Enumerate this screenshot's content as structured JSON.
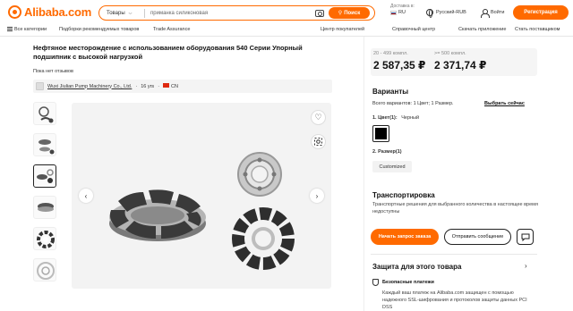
{
  "header": {
    "logo_text": "Alibaba.com",
    "search_category": "Товары",
    "search_query": "приманка силиконовая",
    "search_button": "Поиск",
    "deliver_to_label": "Доставка в:",
    "deliver_to_country": "RU",
    "language_currency": "Русский-RUB",
    "login": "Войти",
    "register": "Регистрация"
  },
  "subnav": {
    "all_categories": "Все категории",
    "recommended": "Подборки рекомендуемых товаров",
    "trade_assurance": "Trade Assurance",
    "buyer_center": "Центр покупателей",
    "help_center": "Справочный центр",
    "download_app": "Скачать приложение",
    "become_supplier": "Стать поставщиком"
  },
  "product": {
    "title": "Нефтяное месторождение с использованием оборудования 540 Серии Упорный подшипник с высокой нагрузкой",
    "reviews": "Пока нет отзывов",
    "supplier_name": "Wuxi Jiulian Pump Machinery Co., Ltd.",
    "supplier_years": "16 yrs",
    "supplier_country": "CN"
  },
  "pricing": {
    "tier1_label": "20 - 499 компл.",
    "tier1_price": "2 587,35 ₽",
    "tier2_label": ">= 500 компл.",
    "tier2_price": "2 371,74 ₽"
  },
  "variants": {
    "title": "Варианты",
    "summary": "Всего вариантов: 1 Цвет; 1 Размер.",
    "choose_link": "Выбрать сейчас",
    "color_label": "1. Цвет(1):",
    "color_value": "Черный",
    "size_label": "2. Размер(1)",
    "size_option": "Customized"
  },
  "shipping": {
    "title": "Транспортировка",
    "text": "Транспортные решения для выбранного количества в настоящее время недоступны"
  },
  "actions": {
    "request_quote": "Начать запрос заказа",
    "send_message": "Отправить сообщение"
  },
  "protection": {
    "title": "Защита для этого товара",
    "payments_title": "Безопасные платежи",
    "payments_text": "Каждый ваш платеж на Alibaba.com защищен с помощью надежного SSL-шифрования и протоколов защиты данных PCI DSS"
  },
  "colors": {
    "accent": "#ff6a00",
    "text": "#222222"
  }
}
